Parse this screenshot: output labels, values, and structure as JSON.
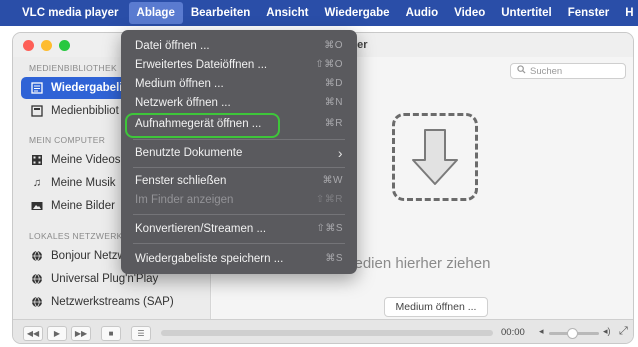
{
  "menubar": {
    "app": "VLC media player",
    "items": [
      "Ablage",
      "Bearbeiten",
      "Ansicht",
      "Wiedergabe",
      "Audio",
      "Video",
      "Untertitel",
      "Fenster",
      "H"
    ]
  },
  "window": {
    "title": "yer"
  },
  "sidebar": {
    "section1": "MEDIENBIBLIOTHEK",
    "items1": [
      {
        "label": "Wiedergabeli",
        "icon": "playlist-icon"
      },
      {
        "label": "Medienbibliot",
        "icon": "library-icon"
      }
    ],
    "section2": "MEIN COMPUTER",
    "items2": [
      {
        "label": "Meine Videos",
        "icon": "film-icon"
      },
      {
        "label": "Meine Musik",
        "icon": "music-note-icon"
      },
      {
        "label": "Meine Bilder",
        "icon": "picture-icon"
      }
    ],
    "section3": "LOKALES NETZWERK",
    "items3": [
      {
        "label": "Bonjour Netzw",
        "icon": "globe-icon"
      },
      {
        "label": "Universal Plug'n'Play",
        "icon": "globe-icon"
      },
      {
        "label": "Netzwerkstreams (SAP)",
        "icon": "globe-icon"
      }
    ]
  },
  "main": {
    "search_placeholder": "Suchen",
    "drop_hint": "Medien hierher ziehen",
    "open_button": "Medium öffnen ..."
  },
  "controls": {
    "time": "00:00"
  },
  "menu": {
    "items": [
      {
        "label": "Datei öffnen ...",
        "shortcut": "⌘O",
        "disabled": false
      },
      {
        "label": "Erweitertes Dateiöffnen ...",
        "shortcut": "⇧⌘O",
        "disabled": false
      },
      {
        "label": "Medium öffnen ...",
        "shortcut": "⌘D",
        "disabled": false
      },
      {
        "label": "Netzwerk öffnen ...",
        "shortcut": "⌘N",
        "disabled": false
      },
      {
        "label": "Aufnahmegerät öffnen ...",
        "shortcut": "⌘R",
        "disabled": false
      },
      {
        "label": "Benutzte Dokumente",
        "shortcut": "›",
        "disabled": false
      },
      {
        "label": "Fenster schließen",
        "shortcut": "⌘W",
        "disabled": false
      },
      {
        "label": "Im Finder anzeigen",
        "shortcut": "⇧⌘R",
        "disabled": true
      },
      {
        "label": "Konvertieren/Streamen ...",
        "shortcut": "⇧⌘S",
        "disabled": false
      },
      {
        "label": "Wiedergabeliste speichern ...",
        "shortcut": "⌘S",
        "disabled": false
      }
    ],
    "highlight_color": "#3ec63a",
    "accent": "#2f63d6"
  }
}
